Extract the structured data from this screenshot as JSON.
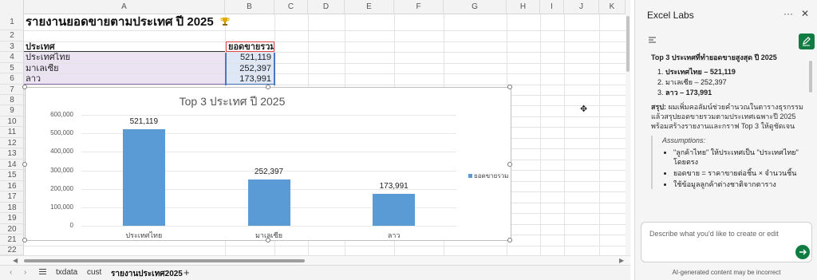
{
  "sheet": {
    "columns": [
      "A",
      "B",
      "C",
      "D",
      "E",
      "F",
      "G",
      "H",
      "I",
      "J",
      "K"
    ],
    "rows": [
      "1",
      "2",
      "3",
      "4",
      "5",
      "6",
      "7",
      "8",
      "9",
      "10",
      "11",
      "12",
      "13",
      "14",
      "15",
      "16",
      "17",
      "18",
      "19",
      "20",
      "21",
      "22"
    ],
    "title": "รายงานยอดขายตามประเทศ ปี 2025",
    "table": {
      "header_country": "ประเทศ",
      "header_sales": "ยอดขายรวม",
      "rows": [
        {
          "country": "ประเทศไทย",
          "sales": "521,119"
        },
        {
          "country": "มาเลเซีย",
          "sales": "252,397"
        },
        {
          "country": "ลาว",
          "sales": "173,991"
        }
      ]
    }
  },
  "chart_data": {
    "type": "bar",
    "title": "Top 3 ประเทศ ปี 2025",
    "categories": [
      "ประเทศไทย",
      "มาเลเซีย",
      "ลาว"
    ],
    "series": [
      {
        "name": "ยอดขายรวม",
        "values": [
          521119,
          252397,
          173991
        ]
      }
    ],
    "data_labels": [
      "521,119",
      "252,397",
      "173,991"
    ],
    "yticks": [
      "600,000",
      "500,000",
      "400,000",
      "300,000",
      "200,000",
      "100,000",
      "0"
    ],
    "ylim": [
      0,
      600000
    ],
    "grid": true,
    "legend": "right",
    "color": "#5b9bd5"
  },
  "tabs": {
    "menu_icon": "hamburger-icon",
    "add_icon": "plus-icon",
    "items": [
      {
        "label": "txdata"
      },
      {
        "label": "cust"
      },
      {
        "label": "รายงานประเทศ2025"
      }
    ],
    "add": "+"
  },
  "pane": {
    "title": "Excel Labs",
    "more": "···",
    "close": "✕",
    "heading": "Top 3 ประเทศที่ทำยอดขายสูงสุด ปี 2025",
    "list": [
      "ประเทศไทย – 521,119",
      "มาเลเซีย – 252,397",
      "ลาว – 173,991"
    ],
    "summary_label": "สรุป:",
    "summary": "ผมเพิ่มคอลัมน์ช่วยคำนวณในตารางธุรกรรม แล้วสรุปยอดขายรวมตามประเทศเฉพาะปี 2025 พร้อมสร้างรายงานและกราฟ Top 3 ให้ดูชัดเจน",
    "assumptions_title": "Assumptions:",
    "assumptions": [
      "\"ลูกค้าไทย\" ให้ประเทศเป็น \"ประเทศไทย\" โดยตรง",
      "ยอดขาย = ราคาขายต่อชิ้น × จำนวนชิ้น",
      "ใช้ข้อมูลลูกค้าต่างชาติจากตาราง"
    ],
    "input_placeholder": "Describe what you'd like to create or edit",
    "disclaimer": "AI-generated content may be incorrect",
    "accent": "#107c41"
  }
}
